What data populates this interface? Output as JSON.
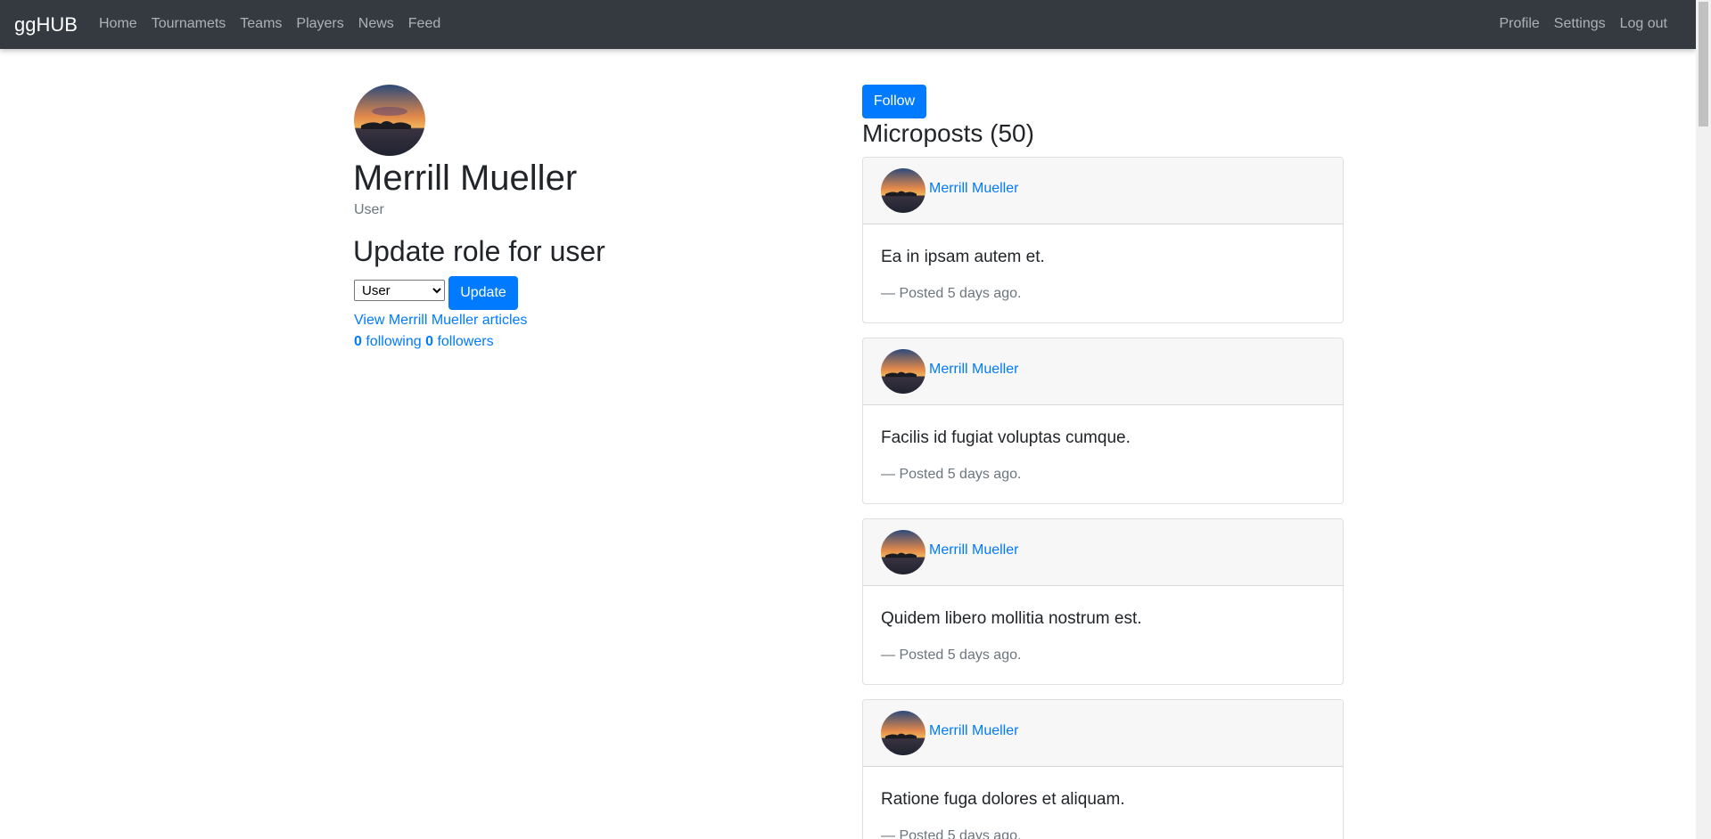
{
  "navbar": {
    "brand": "ggHUB",
    "left_links": [
      "Home",
      "Tournamets",
      "Teams",
      "Players",
      "News",
      "Feed"
    ],
    "right_links": [
      "Profile",
      "Settings",
      "Log out"
    ]
  },
  "profile": {
    "name": "Merrill Mueller",
    "role": "User",
    "update_heading": "Update role for user",
    "role_select_value": "User",
    "update_button": "Update",
    "articles_link": "View Merrill Mueller articles",
    "following_count": "0",
    "following_label": "following",
    "followers_count": "0",
    "followers_label": "followers"
  },
  "feed": {
    "follow_button": "Follow",
    "heading": "Microposts (50)",
    "posts": [
      {
        "author": "Merrill Mueller",
        "text": "Ea in ipsam autem et.",
        "meta": "— Posted 5 days ago."
      },
      {
        "author": "Merrill Mueller",
        "text": "Facilis id fugiat voluptas cumque.",
        "meta": "— Posted 5 days ago."
      },
      {
        "author": "Merrill Mueller",
        "text": "Quidem libero mollitia nostrum est.",
        "meta": "— Posted 5 days ago."
      },
      {
        "author": "Merrill Mueller",
        "text": "Ratione fuga dolores et aliquam.",
        "meta": "— Posted 5 days ago."
      }
    ]
  },
  "colors": {
    "navbar_bg": "#343a40",
    "primary": "#007bff",
    "muted": "#6c757d"
  }
}
